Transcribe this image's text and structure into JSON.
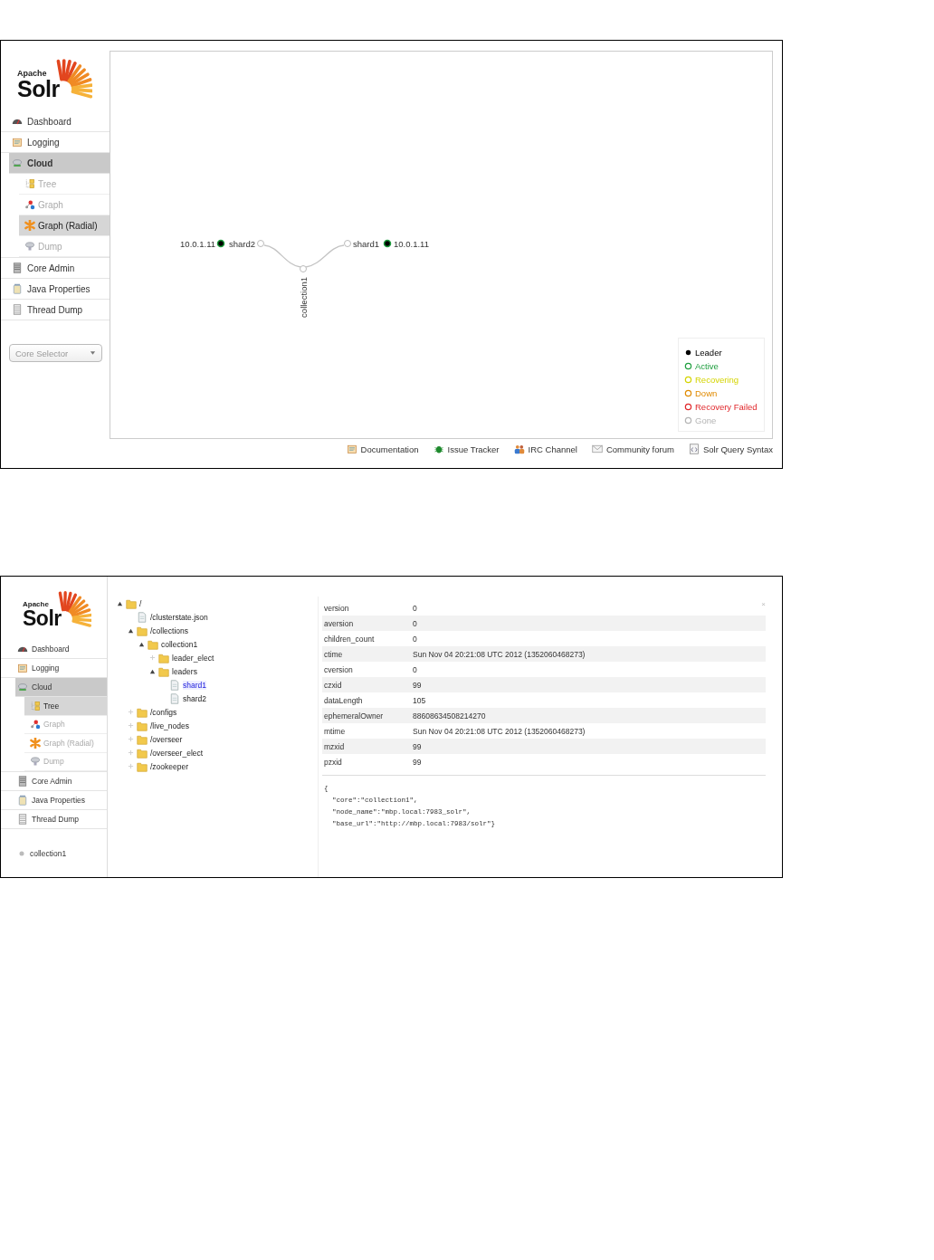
{
  "graph_view": {
    "logo": {
      "small": "Apache",
      "big": "Solr"
    },
    "nav": [
      {
        "label": "Dashboard",
        "selected": false
      },
      {
        "label": "Logging",
        "selected": false
      },
      {
        "label": "Cloud",
        "selected": true,
        "children": [
          {
            "label": "Tree",
            "selected": false
          },
          {
            "label": "Graph",
            "selected": false
          },
          {
            "label": "Graph (Radial)",
            "selected": true
          },
          {
            "label": "Dump",
            "selected": false
          }
        ]
      },
      {
        "label": "Core Admin",
        "selected": false
      },
      {
        "label": "Java Properties",
        "selected": false
      },
      {
        "label": "Thread Dump",
        "selected": false
      }
    ],
    "core_selector": {
      "placeholder": "Core Selector"
    },
    "graph": {
      "root": "collection1",
      "shards": [
        {
          "name": "shard2",
          "node": "10.0.1.11",
          "leader": true,
          "color": "#1e9e3e"
        },
        {
          "name": "shard1",
          "node": "10.0.1.11",
          "leader": true,
          "color": "#1e9e3e"
        }
      ]
    },
    "legend": [
      {
        "label": "Leader",
        "kind": "dot",
        "color": "#000000"
      },
      {
        "label": "Active",
        "kind": "ring",
        "color": "#1e9e3e"
      },
      {
        "label": "Recovering",
        "kind": "ring",
        "color": "#d4d400"
      },
      {
        "label": "Down",
        "kind": "ring",
        "color": "#e08a00"
      },
      {
        "label": "Recovery Failed",
        "kind": "ring",
        "color": "#e0262a"
      },
      {
        "label": "Gone",
        "kind": "ring",
        "color": "#b4b4b4"
      }
    ],
    "footer_links": [
      "Documentation",
      "Issue Tracker",
      "IRC Channel",
      "Community forum",
      "Solr Query Syntax"
    ]
  },
  "tree_view": {
    "logo": {
      "small": "Apache",
      "big": "Solr"
    },
    "nav": [
      {
        "label": "Dashboard",
        "selected": false
      },
      {
        "label": "Logging",
        "selected": false
      },
      {
        "label": "Cloud",
        "selected": true,
        "children": [
          {
            "label": "Tree",
            "selected": true
          },
          {
            "label": "Graph",
            "selected": false
          },
          {
            "label": "Graph (Radial)",
            "selected": false
          },
          {
            "label": "Dump",
            "selected": false
          }
        ]
      },
      {
        "label": "Core Admin",
        "selected": false
      },
      {
        "label": "Java Properties",
        "selected": false
      },
      {
        "label": "Thread Dump",
        "selected": false
      }
    ],
    "cores": [
      "collection1"
    ],
    "tree": [
      {
        "label": "/",
        "kind": "folder",
        "expanded": true,
        "selected": false,
        "children": [
          {
            "label": "/clusterstate.json",
            "kind": "file",
            "selected": false
          },
          {
            "label": "/collections",
            "kind": "folder",
            "expanded": true,
            "selected": false,
            "children": [
              {
                "label": "collection1",
                "kind": "folder",
                "expanded": true,
                "selected": false,
                "children": [
                  {
                    "label": "leader_elect",
                    "kind": "folder",
                    "expanded": false,
                    "selected": false
                  },
                  {
                    "label": "leaders",
                    "kind": "folder",
                    "expanded": true,
                    "selected": false,
                    "children": [
                      {
                        "label": "shard1",
                        "kind": "file",
                        "selected": true
                      },
                      {
                        "label": "shard2",
                        "kind": "file",
                        "selected": false
                      }
                    ]
                  }
                ]
              }
            ]
          },
          {
            "label": "/configs",
            "kind": "folder",
            "expanded": false,
            "selected": false
          },
          {
            "label": "/live_nodes",
            "kind": "folder",
            "expanded": false,
            "selected": false
          },
          {
            "label": "/overseer",
            "kind": "folder",
            "expanded": false,
            "selected": false
          },
          {
            "label": "/overseer_elect",
            "kind": "folder",
            "expanded": false,
            "selected": false
          },
          {
            "label": "/zookeeper",
            "kind": "folder",
            "expanded": false,
            "selected": false
          }
        ]
      }
    ],
    "close": "×",
    "properties": [
      {
        "key": "version",
        "value": "0"
      },
      {
        "key": "aversion",
        "value": "0"
      },
      {
        "key": "children_count",
        "value": "0"
      },
      {
        "key": "ctime",
        "value": "Sun Nov 04 20:21:08 UTC 2012 (1352060468273)"
      },
      {
        "key": "cversion",
        "value": "0"
      },
      {
        "key": "czxid",
        "value": "99"
      },
      {
        "key": "dataLength",
        "value": "105"
      },
      {
        "key": "ephemeralOwner",
        "value": "88608634508214270"
      },
      {
        "key": "mtime",
        "value": "Sun Nov 04 20:21:08 UTC 2012 (1352060468273)"
      },
      {
        "key": "mzxid",
        "value": "99"
      },
      {
        "key": "pzxid",
        "value": "99"
      }
    ],
    "data": "{\n  \"core\":\"collection1\",\n  \"node_name\":\"mbp.local:7983_solr\",\n  \"base_url\":\"http://mbp.local:7983/solr\"}"
  }
}
